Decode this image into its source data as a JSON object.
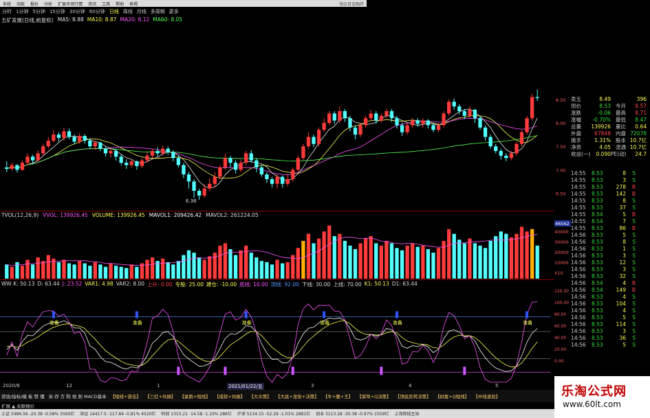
{
  "menu": {
    "items": [
      "系统",
      "功能",
      "报价",
      "分析",
      "扩展市场行情",
      "资讯",
      "工具",
      "帮助",
      "表揭"
    ],
    "brand": "海达目金融终"
  },
  "periods": {
    "items": [
      "分时",
      "1分钟",
      "5分钟",
      "15分钟",
      "30分钟",
      "60分钟",
      "日线",
      "周线",
      "月线",
      "多周期",
      "更多"
    ],
    "active_index": 6
  },
  "main_chart": {
    "title": "五矿发展(日线,前复权)",
    "ma": [
      {
        "label": "MA5: 8.88",
        "color": "#e8e8e8"
      },
      {
        "label": "MA10: 8.87",
        "color": "#ffff55"
      },
      {
        "label": "MA20: 8.12",
        "color": "#ff55ff"
      },
      {
        "label": "MA60: 8.05",
        "color": "#55ff55"
      }
    ],
    "y_ticks": [
      "8.50",
      "8.00",
      "7.50",
      "7.00",
      "6.50"
    ],
    "low_label": "6.36",
    "y_range": [
      6.2,
      8.6
    ]
  },
  "vol_chart": {
    "labels": [
      {
        "text": "TVOL(12,26,9)",
        "color": "#dddddd"
      },
      {
        "text": "VVOL: 139926.45",
        "color": "#ff55ff"
      },
      {
        "text": "VOLUME: 139926.45",
        "color": "#ffff55"
      },
      {
        "text": "MAVOL1: 209426.42",
        "color": "#ffffff"
      },
      {
        "text": "MAVOL2: 261224.05",
        "color": "#dddddd"
      }
    ],
    "y_ticks": [
      "40000",
      "30000",
      "20000",
      "10000",
      "X10"
    ],
    "highlight": "46562"
  },
  "ind_chart": {
    "labels": [
      {
        "text": "WW K: 50.13",
        "color": "#dddddd"
      },
      {
        "text": "D: 63.44",
        "color": "#dddddd"
      },
      {
        "text": "J: 23.52",
        "color": "#ff55ff"
      },
      {
        "text": "VAR1: 4.98",
        "color": "#ffff55"
      },
      {
        "text": "VAR2: 8.00",
        "color": "#dddddd"
      },
      {
        "text": "上升: 0.00",
        "color": "#ff4444"
      },
      {
        "text": "专股: 25.00",
        "color": "#ffff55"
      },
      {
        "text": "建仓: -10.00",
        "color": "#ffff55"
      },
      {
        "text": "底线: 10.00",
        "color": "#ff55ff"
      },
      {
        "text": "顶线: 92.00",
        "color": "#5599ff"
      },
      {
        "text": "下线: 30.00",
        "color": "#dddddd"
      },
      {
        "text": "上线: 70.00",
        "color": "#dddddd"
      },
      {
        "text": "K1: 50.13",
        "color": "#ffff55"
      },
      {
        "text": "D1: 63.44",
        "color": "#dddddd"
      }
    ],
    "y_ticks": [
      "120.00",
      "100.00",
      "80.00",
      "60.00",
      "40.00",
      "20.00",
      "0.00"
    ],
    "signal_label": "准备"
  },
  "axis": {
    "labels": [
      "2020/8",
      "12",
      "1",
      "2021/01/22/五",
      "3",
      "4",
      "5"
    ]
  },
  "funcbar": {
    "items": [
      "资钱/指标/模 板 赞 懂",
      "另 存 方 购 规 则 MACD基本",
      "【短线+游击】",
      "【三红+共振】",
      "【紧跑+短线】",
      "【成就+共振】",
      "【大众策】",
      "【大底+龙抬+决策】",
      "【牛+魔+王】",
      "【保驾+Q决策】",
      "【顶底反转决策】",
      "【财富+Q短线】",
      "【中线波段】"
    ],
    "sub": "扩展 ▲  关联报价"
  },
  "statusbar": {
    "items": [
      "上证 3486.56 -20.38 -0.58% 3560亿",
      "深证 14417.5 -117.84 -0.81% 4520亿",
      "科创 1315.21 -14.58 -1.10% 286亿",
      "沪深 5134.15 -52.29 -1.01% 2881亿",
      "创业 3113.28 -30.38 -0.97% 1559亿",
      "上海双线主站"
    ]
  },
  "quote": {
    "rows": [
      {
        "k": "卖五",
        "v": "8.49",
        "k2": "",
        "v2": "396",
        "vc": "#ffff55",
        "v2c": "#ffff55"
      },
      {
        "k": "现价",
        "v": "8.53",
        "k2": "今开",
        "v2": "8.57",
        "vc": "#33dd33",
        "v2c": "#ff4444"
      },
      {
        "k": "涨跌",
        "v": "-0.06",
        "k2": "最高",
        "v2": "8.71",
        "vc": "#33dd33",
        "v2c": "#ff4444"
      },
      {
        "k": "涨幅",
        "v": "-0.70%",
        "k2": "最低",
        "v2": "8.47",
        "vc": "#33dd33",
        "v2c": "#33dd33"
      },
      {
        "k": "总量",
        "v": "139926",
        "k2": "量比",
        "v2": "0.64",
        "vc": "#ffff55",
        "v2c": "#ffff55"
      },
      {
        "k": "外盘",
        "v": "67848",
        "k2": "内盘",
        "v2": "72078",
        "vc": "#ff4444",
        "v2c": "#33dd33"
      },
      {
        "k": "换手",
        "v": "1.31%",
        "k2": "股本",
        "v2": "10.7亿",
        "vc": "#ffff55",
        "v2c": "#ffff55"
      },
      {
        "k": "净资",
        "v": "4.05",
        "k2": "流通",
        "v2": "10.7亿",
        "vc": "#ffff55",
        "v2c": "#ffff55"
      },
      {
        "k": "收益(一)",
        "v": "0.090",
        "k2": "PE(动)",
        "v2": "24.7",
        "vc": "#ffff55",
        "v2c": "#ffff55"
      }
    ]
  },
  "ticks": {
    "rows": [
      {
        "t": "14:55",
        "p": "8.53",
        "v": "8",
        "s": "S",
        "pc": "#33dd33",
        "sc": "#33dd33"
      },
      {
        "t": "14:55",
        "p": "8.53",
        "v": "3",
        "s": "S",
        "pc": "#33dd33",
        "sc": "#33dd33"
      },
      {
        "t": "14:55",
        "p": "8.53",
        "v": "278",
        "s": "B",
        "pc": "#33dd33",
        "sc": "#ff4444"
      },
      {
        "t": "14:55",
        "p": "8.53",
        "v": "142",
        "s": "B",
        "pc": "#33dd33",
        "sc": "#ff4444"
      },
      {
        "t": "14:55",
        "p": "8.53",
        "v": "8",
        "s": "S",
        "pc": "#33dd33",
        "sc": "#33dd33"
      },
      {
        "t": "14:55",
        "p": "8.53",
        "v": "37",
        "s": "S",
        "pc": "#33dd33",
        "sc": "#33dd33"
      },
      {
        "t": "14:55",
        "p": "8.54",
        "v": "5",
        "s": "B",
        "pc": "#33dd33",
        "sc": "#ff4444"
      },
      {
        "t": "14:55",
        "p": "8.54",
        "v": "7",
        "s": "S",
        "pc": "#33dd33",
        "sc": "#33dd33"
      },
      {
        "t": "14:55",
        "p": "8.53",
        "v": "86",
        "s": "B",
        "pc": "#33dd33",
        "sc": "#ff4444"
      },
      {
        "t": "14:56",
        "p": "8.53",
        "v": "5",
        "s": "S",
        "pc": "#33dd33",
        "sc": "#33dd33"
      },
      {
        "t": "14:56",
        "p": "8.53",
        "v": "8",
        "s": "S",
        "pc": "#33dd33",
        "sc": "#33dd33"
      },
      {
        "t": "14:56",
        "p": "8.53",
        "v": "1",
        "s": "S",
        "pc": "#33dd33",
        "sc": "#33dd33"
      },
      {
        "t": "14:56",
        "p": "8.53",
        "v": "3",
        "s": "S",
        "pc": "#33dd33",
        "sc": "#33dd33"
      },
      {
        "t": "14:56",
        "p": "8.53",
        "v": "12",
        "s": "S",
        "pc": "#33dd33",
        "sc": "#33dd33"
      },
      {
        "t": "14:56",
        "p": "8.53",
        "v": "3",
        "s": "S",
        "pc": "#33dd33",
        "sc": "#33dd33"
      },
      {
        "t": "14:56",
        "p": "8.53",
        "v": "32",
        "s": "S",
        "pc": "#33dd33",
        "sc": "#33dd33"
      },
      {
        "t": "14:56",
        "p": "8.54",
        "v": "4",
        "s": "B",
        "pc": "#33dd33",
        "sc": "#ff4444"
      },
      {
        "t": "14:56",
        "p": "8.54",
        "v": "149",
        "s": "B",
        "pc": "#33dd33",
        "sc": "#ff4444"
      },
      {
        "t": "14:56",
        "p": "8.53",
        "v": "4",
        "s": "S",
        "pc": "#33dd33",
        "sc": "#33dd33"
      },
      {
        "t": "14:56",
        "p": "8.53",
        "v": "104",
        "s": "S",
        "pc": "#33dd33",
        "sc": "#33dd33"
      },
      {
        "t": "14:56",
        "p": "8.53",
        "v": "4",
        "s": "S",
        "pc": "#33dd33",
        "sc": "#33dd33"
      },
      {
        "t": "14:56",
        "p": "8.53",
        "v": "5",
        "s": "S",
        "pc": "#33dd33",
        "sc": "#33dd33"
      },
      {
        "t": "14:56",
        "p": "8.53",
        "v": "114",
        "s": "S",
        "pc": "#33dd33",
        "sc": "#33dd33"
      },
      {
        "t": "14:56",
        "p": "8.53",
        "v": "3",
        "s": "S",
        "pc": "#33dd33",
        "sc": "#33dd33"
      },
      {
        "t": "14:56",
        "p": "8.53",
        "v": "36",
        "s": "S",
        "pc": "#33dd33",
        "sc": "#33dd33"
      },
      {
        "t": "14:56",
        "p": "8.53",
        "v": "5",
        "s": "S",
        "pc": "#33dd33",
        "sc": "#33dd33"
      }
    ]
  },
  "watermark": {
    "title": "乐淘公式网",
    "url": "www.60lt.com"
  },
  "chart_data": {
    "type": "candlestick",
    "ohlc": [
      [
        7.05,
        7.02,
        7.18,
        6.95
      ],
      [
        7.02,
        7.1,
        7.15,
        6.98
      ],
      [
        7.1,
        7.0,
        7.12,
        6.94
      ],
      [
        7.0,
        7.15,
        7.2,
        6.98
      ],
      [
        7.15,
        7.28,
        7.35,
        7.1
      ],
      [
        7.28,
        7.2,
        7.32,
        7.12
      ],
      [
        7.2,
        7.35,
        7.42,
        7.18
      ],
      [
        7.35,
        7.5,
        7.55,
        7.3
      ],
      [
        7.5,
        7.62,
        7.7,
        7.45
      ],
      [
        7.62,
        7.75,
        7.85,
        7.58
      ],
      [
        7.75,
        7.68,
        7.8,
        7.6
      ],
      [
        7.68,
        7.82,
        7.9,
        7.62
      ],
      [
        7.82,
        7.7,
        7.88,
        7.65
      ],
      [
        7.7,
        7.6,
        7.75,
        7.55
      ],
      [
        7.6,
        7.72,
        7.78,
        7.55
      ],
      [
        7.72,
        7.62,
        7.76,
        7.56
      ],
      [
        7.62,
        7.5,
        7.68,
        7.45
      ],
      [
        7.5,
        7.58,
        7.62,
        7.42
      ],
      [
        7.58,
        7.45,
        7.6,
        7.4
      ],
      [
        7.45,
        7.35,
        7.5,
        7.28
      ],
      [
        7.35,
        7.4,
        7.45,
        7.26
      ],
      [
        7.4,
        7.28,
        7.44,
        7.2
      ],
      [
        7.28,
        7.15,
        7.32,
        7.1
      ],
      [
        7.15,
        7.1,
        7.22,
        7.02
      ],
      [
        7.1,
        7.18,
        7.22,
        7.05
      ],
      [
        7.18,
        7.08,
        7.2,
        7.0
      ],
      [
        7.08,
        7.2,
        7.25,
        7.04
      ],
      [
        7.2,
        7.3,
        7.38,
        7.15
      ],
      [
        7.3,
        7.4,
        7.45,
        7.25
      ],
      [
        7.4,
        7.35,
        7.48,
        7.28
      ],
      [
        7.35,
        7.45,
        7.52,
        7.3
      ],
      [
        7.45,
        7.38,
        7.5,
        7.32
      ],
      [
        7.38,
        7.25,
        7.42,
        7.18
      ],
      [
        7.25,
        7.1,
        7.3,
        7.05
      ],
      [
        7.1,
        6.9,
        7.15,
        6.82
      ],
      [
        6.9,
        6.75,
        6.95,
        6.6
      ],
      [
        6.75,
        6.55,
        6.8,
        6.4
      ],
      [
        6.55,
        6.45,
        6.6,
        6.36
      ],
      [
        6.45,
        6.6,
        6.7,
        6.4
      ],
      [
        6.6,
        6.7,
        6.82,
        6.55
      ],
      [
        6.7,
        6.85,
        6.95,
        6.62
      ],
      [
        6.85,
        7.05,
        7.1,
        6.8
      ],
      [
        7.05,
        7.25,
        7.35,
        7.0
      ],
      [
        7.25,
        7.15,
        7.3,
        7.05
      ],
      [
        7.15,
        7.0,
        7.2,
        6.92
      ],
      [
        7.0,
        7.15,
        7.22,
        6.95
      ],
      [
        7.15,
        7.35,
        7.4,
        7.1
      ],
      [
        7.35,
        7.2,
        7.42,
        7.15
      ],
      [
        7.2,
        7.05,
        7.25,
        6.95
      ],
      [
        7.05,
        6.9,
        7.1,
        6.85
      ],
      [
        6.9,
        6.8,
        6.95,
        6.72
      ],
      [
        6.8,
        6.7,
        6.85,
        6.62
      ],
      [
        6.7,
        6.85,
        6.9,
        6.6
      ],
      [
        6.85,
        6.7,
        6.88,
        6.62
      ],
      [
        6.7,
        6.8,
        6.9,
        6.65
      ],
      [
        6.8,
        7.0,
        7.05,
        6.75
      ],
      [
        7.0,
        7.25,
        7.3,
        6.95
      ],
      [
        7.25,
        7.5,
        7.55,
        7.2
      ],
      [
        7.5,
        7.7,
        7.8,
        7.45
      ],
      [
        7.7,
        7.55,
        7.75,
        7.48
      ],
      [
        7.55,
        7.85,
        7.9,
        7.5
      ],
      [
        7.85,
        8.0,
        8.1,
        7.8
      ],
      [
        8.0,
        8.2,
        8.25,
        7.95
      ],
      [
        8.2,
        8.05,
        8.25,
        7.98
      ],
      [
        8.05,
        8.25,
        8.35,
        8.0
      ],
      [
        8.25,
        8.1,
        8.3,
        8.02
      ],
      [
        8.1,
        7.9,
        8.15,
        7.82
      ],
      [
        7.9,
        7.75,
        7.95,
        7.65
      ],
      [
        7.75,
        7.95,
        8.0,
        7.7
      ],
      [
        7.95,
        8.1,
        8.15,
        7.9
      ],
      [
        8.1,
        8.2,
        8.28,
        8.05
      ],
      [
        8.2,
        8.05,
        8.25,
        7.98
      ],
      [
        8.05,
        8.15,
        8.2,
        8.0
      ],
      [
        8.15,
        8.25,
        8.3,
        8.1
      ],
      [
        8.25,
        8.1,
        8.3,
        8.02
      ],
      [
        8.1,
        7.95,
        8.15,
        7.88
      ],
      [
        7.95,
        7.8,
        8.0,
        7.72
      ],
      [
        7.8,
        7.95,
        8.0,
        7.75
      ],
      [
        7.95,
        8.05,
        8.1,
        7.9
      ],
      [
        8.05,
        7.98,
        8.1,
        7.92
      ],
      [
        7.98,
        8.05,
        8.1,
        7.9
      ],
      [
        8.05,
        7.95,
        8.08,
        7.88
      ],
      [
        7.95,
        7.85,
        8.0,
        7.8
      ],
      [
        7.85,
        7.95,
        8.0,
        7.8
      ],
      [
        7.95,
        8.2,
        8.25,
        7.9
      ],
      [
        8.2,
        8.45,
        8.5,
        8.15
      ],
      [
        8.45,
        8.35,
        8.52,
        8.28
      ],
      [
        8.35,
        8.25,
        8.4,
        8.18
      ],
      [
        8.25,
        8.15,
        8.3,
        8.08
      ],
      [
        8.15,
        8.28,
        8.35,
        8.1
      ],
      [
        8.28,
        8.1,
        8.3,
        8.0
      ],
      [
        8.1,
        7.9,
        8.15,
        7.85
      ],
      [
        7.9,
        7.7,
        7.95,
        7.62
      ],
      [
        7.7,
        7.5,
        7.75,
        7.45
      ],
      [
        7.5,
        7.4,
        7.55,
        7.35
      ],
      [
        7.4,
        7.3,
        7.45,
        7.22
      ],
      [
        7.3,
        7.25,
        7.35,
        7.18
      ],
      [
        7.25,
        7.35,
        7.4,
        7.2
      ],
      [
        7.35,
        7.55,
        7.6,
        7.3
      ],
      [
        7.55,
        7.8,
        7.85,
        7.5
      ],
      [
        7.8,
        8.1,
        8.15,
        7.75
      ],
      [
        8.1,
        8.55,
        8.62,
        8.05
      ],
      [
        8.55,
        8.53,
        8.71,
        8.47
      ]
    ],
    "volume": [
      12,
      10,
      14,
      11,
      16,
      12,
      18,
      15,
      20,
      17,
      14,
      16,
      13,
      12,
      15,
      13,
      11,
      14,
      12,
      10,
      13,
      11,
      10,
      9,
      12,
      10,
      13,
      16,
      18,
      15,
      17,
      14,
      12,
      15,
      20,
      24,
      22,
      18,
      16,
      19,
      22,
      28,
      30,
      25,
      20,
      24,
      28,
      22,
      18,
      15,
      14,
      12,
      16,
      13,
      14,
      20,
      26,
      32,
      38,
      30,
      34,
      40,
      45,
      36,
      38,
      32,
      28,
      25,
      30,
      34,
      36,
      30,
      28,
      32,
      30,
      26,
      24,
      28,
      30,
      27,
      28,
      25,
      22,
      26,
      32,
      42,
      38,
      33,
      30,
      34,
      30,
      28,
      26,
      32,
      36,
      40,
      38,
      35,
      38,
      44,
      40,
      42,
      28
    ],
    "ylim": [
      6.2,
      8.6
    ]
  }
}
